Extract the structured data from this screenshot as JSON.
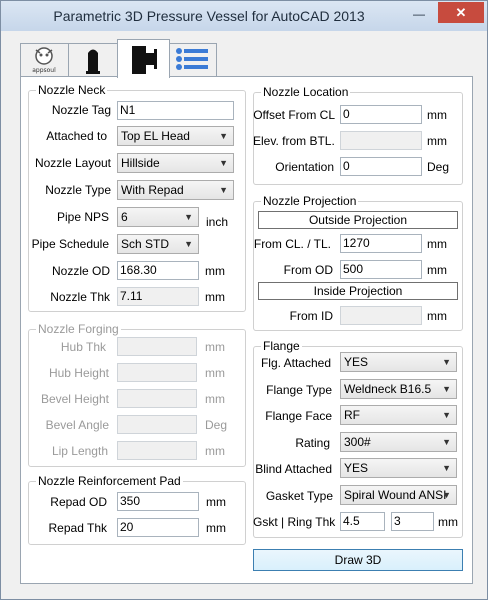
{
  "window": {
    "title": "Parametric 3D Pressure Vessel for AutoCAD 2013",
    "minimize_glyph": "—",
    "close_glyph": "✕"
  },
  "tabs": [
    {
      "icon": "appsoul-logo-icon",
      "logo_text": "appsoul"
    },
    {
      "icon": "vessel-shell-icon"
    },
    {
      "icon": "nozzle-icon"
    },
    {
      "icon": "list-icon"
    }
  ],
  "nozzle_neck": {
    "legend": "Nozzle Neck",
    "tag_label": "Nozzle Tag",
    "tag_value": "N1",
    "attached_label": "Attached to",
    "attached_value": "Top EL Head",
    "layout_label": "Nozzle Layout",
    "layout_value": "Hillside",
    "type_label": "Nozzle Type",
    "type_value": "With Repad",
    "nps_label": "Pipe NPS",
    "nps_value": "6",
    "nps_unit": "inch",
    "schedule_label": "Pipe Schedule",
    "schedule_value": "Sch STD",
    "od_label": "Nozzle OD",
    "od_value": "168.30",
    "od_unit": "mm",
    "thk_label": "Nozzle Thk",
    "thk_value": "7.11",
    "thk_unit": "mm"
  },
  "nozzle_forging": {
    "legend": "Nozzle Forging",
    "hub_thk_label": "Hub Thk",
    "hub_thk_unit": "mm",
    "hub_height_label": "Hub Height",
    "hub_height_unit": "mm",
    "bevel_height_label": "Bevel Height",
    "bevel_height_unit": "mm",
    "bevel_angle_label": "Bevel Angle",
    "bevel_angle_unit": "Deg",
    "lip_length_label": "Lip Length",
    "lip_length_unit": "mm"
  },
  "repad": {
    "legend": "Nozzle Reinforcement Pad",
    "od_label": "Repad OD",
    "od_value": "350",
    "od_unit": "mm",
    "thk_label": "Repad Thk",
    "thk_value": "20",
    "thk_unit": "mm"
  },
  "nozzle_location": {
    "legend": "Nozzle Location",
    "offset_label": "Offset From CL",
    "offset_value": "0",
    "offset_unit": "mm",
    "elev_label": "Elev. from BTL.",
    "elev_unit": "mm",
    "orientation_label": "Orientation",
    "orientation_value": "0",
    "orientation_unit": "Deg"
  },
  "nozzle_projection": {
    "legend": "Nozzle Projection",
    "outside_header": "Outside Projection",
    "from_cl_label": "From CL. / TL.",
    "from_cl_value": "1270",
    "from_cl_unit": "mm",
    "from_od_label": "From OD",
    "from_od_value": "500",
    "from_od_unit": "mm",
    "inside_header": "Inside Projection",
    "from_id_label": "From ID",
    "from_id_unit": "mm"
  },
  "flange": {
    "legend": "Flange",
    "attached_label": "Flg. Attached",
    "attached_value": "YES",
    "type_label": "Flange Type",
    "type_value": "Weldneck B16.5",
    "face_label": "Flange Face",
    "face_value": "RF",
    "rating_label": "Rating",
    "rating_value": "300#",
    "blind_label": "Blind Attached",
    "blind_value": "YES",
    "gasket_label": "Gasket Type",
    "gasket_value": "Spiral Wound ANSI",
    "gskt_label": "Gskt | Ring Thk",
    "gskt_value": "4.5",
    "ring_value": "3",
    "gskt_unit": "mm"
  },
  "draw_button": "Draw 3D"
}
